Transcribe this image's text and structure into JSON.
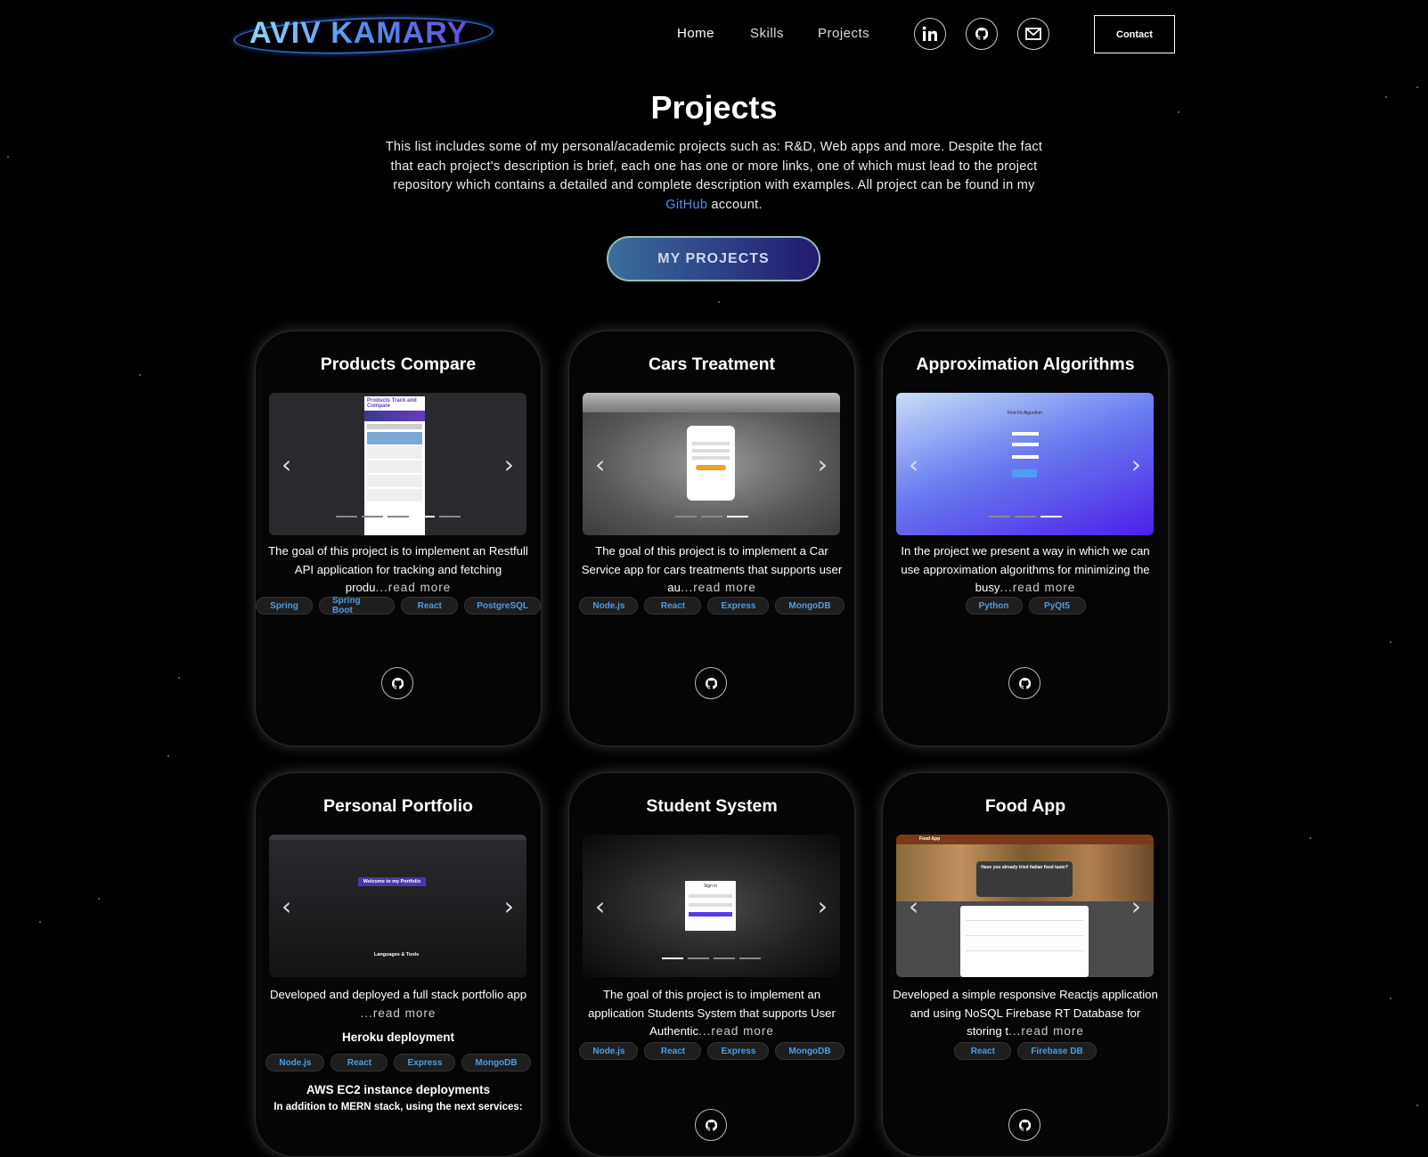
{
  "nav": {
    "logo": "AVIV KAMARY",
    "links": [
      "Home",
      "Skills",
      "Projects"
    ],
    "social": [
      "linkedin-icon",
      "github-icon",
      "mail-icon"
    ],
    "contact": "Contact"
  },
  "hero": {
    "title": "Projects",
    "desc_part1": "This list includes some of my personal/academic projects such as: R&D, Web apps and more. Despite the fact that each project's description is brief, each one has one or more links, one of which must lead to the project repository which contains a detailed and complete description with examples. All project can be found in my ",
    "github_link": "GitHub",
    "desc_part2": " account.",
    "button": "MY PROJECTS"
  },
  "colors": {
    "background": "#000000",
    "tag_text": "#4d9de0",
    "link": "#4d8ff7"
  },
  "projects": [
    {
      "title": "Products Compare",
      "desc": "The goal of this project is to implement an Restfull API application for tracking and fetching produ",
      "more": "...read more",
      "tags": [
        "Spring",
        "Spring Boot",
        "React",
        "PostgreSQL"
      ],
      "dots": 5,
      "active_dot": 3,
      "mock_title": "Products Track and Compare"
    },
    {
      "title": "Cars Treatment",
      "desc": "The goal of this project is to implement a Car Service app for cars treatments that supports user au",
      "more": "...read more",
      "tags": [
        "Node.js",
        "React",
        "Express",
        "MongoDB"
      ],
      "dots": 3,
      "active_dot": 2
    },
    {
      "title": "Approximation Algorithms",
      "desc": "In the project we present a way in which we can use approximation algorithms for minimizing the busy",
      "more": "...read more",
      "tags": [
        "Python",
        "PyQt5"
      ],
      "dots": 3,
      "active_dot": 2,
      "mock_title": "First Fit Algorithm"
    },
    {
      "title": "Personal Portfolio",
      "desc": "Developed and deployed a full stack portfolio app",
      "more": "...read more",
      "heroku": "Heroku deployment",
      "tags": [
        "Node.js",
        "React",
        "Express",
        "MongoDB"
      ],
      "aws": "AWS EC2 instance deployments",
      "aws_sub": "In addition to MERN stack, using the next services:",
      "mock_banner": "Welcome to my Portfolio",
      "mock_section": "Languages & Tools"
    },
    {
      "title": "Student System",
      "desc": "The goal of this project is to implement an application Students System that supports User Authentic",
      "more": "...read more",
      "tags": [
        "Node.js",
        "React",
        "Express",
        "MongoDB"
      ],
      "dots": 4,
      "active_dot": 0,
      "mock_title": "Sign in"
    },
    {
      "title": "Food App",
      "desc": "Developed a simple responsive Reactjs application and using NoSQL Firebase RT Database for storing t",
      "more": "...read more",
      "tags": [
        "React",
        "Firebase DB"
      ],
      "mock_header": "Food App",
      "mock_banner": "Have you already tried Italian food taste?"
    }
  ]
}
